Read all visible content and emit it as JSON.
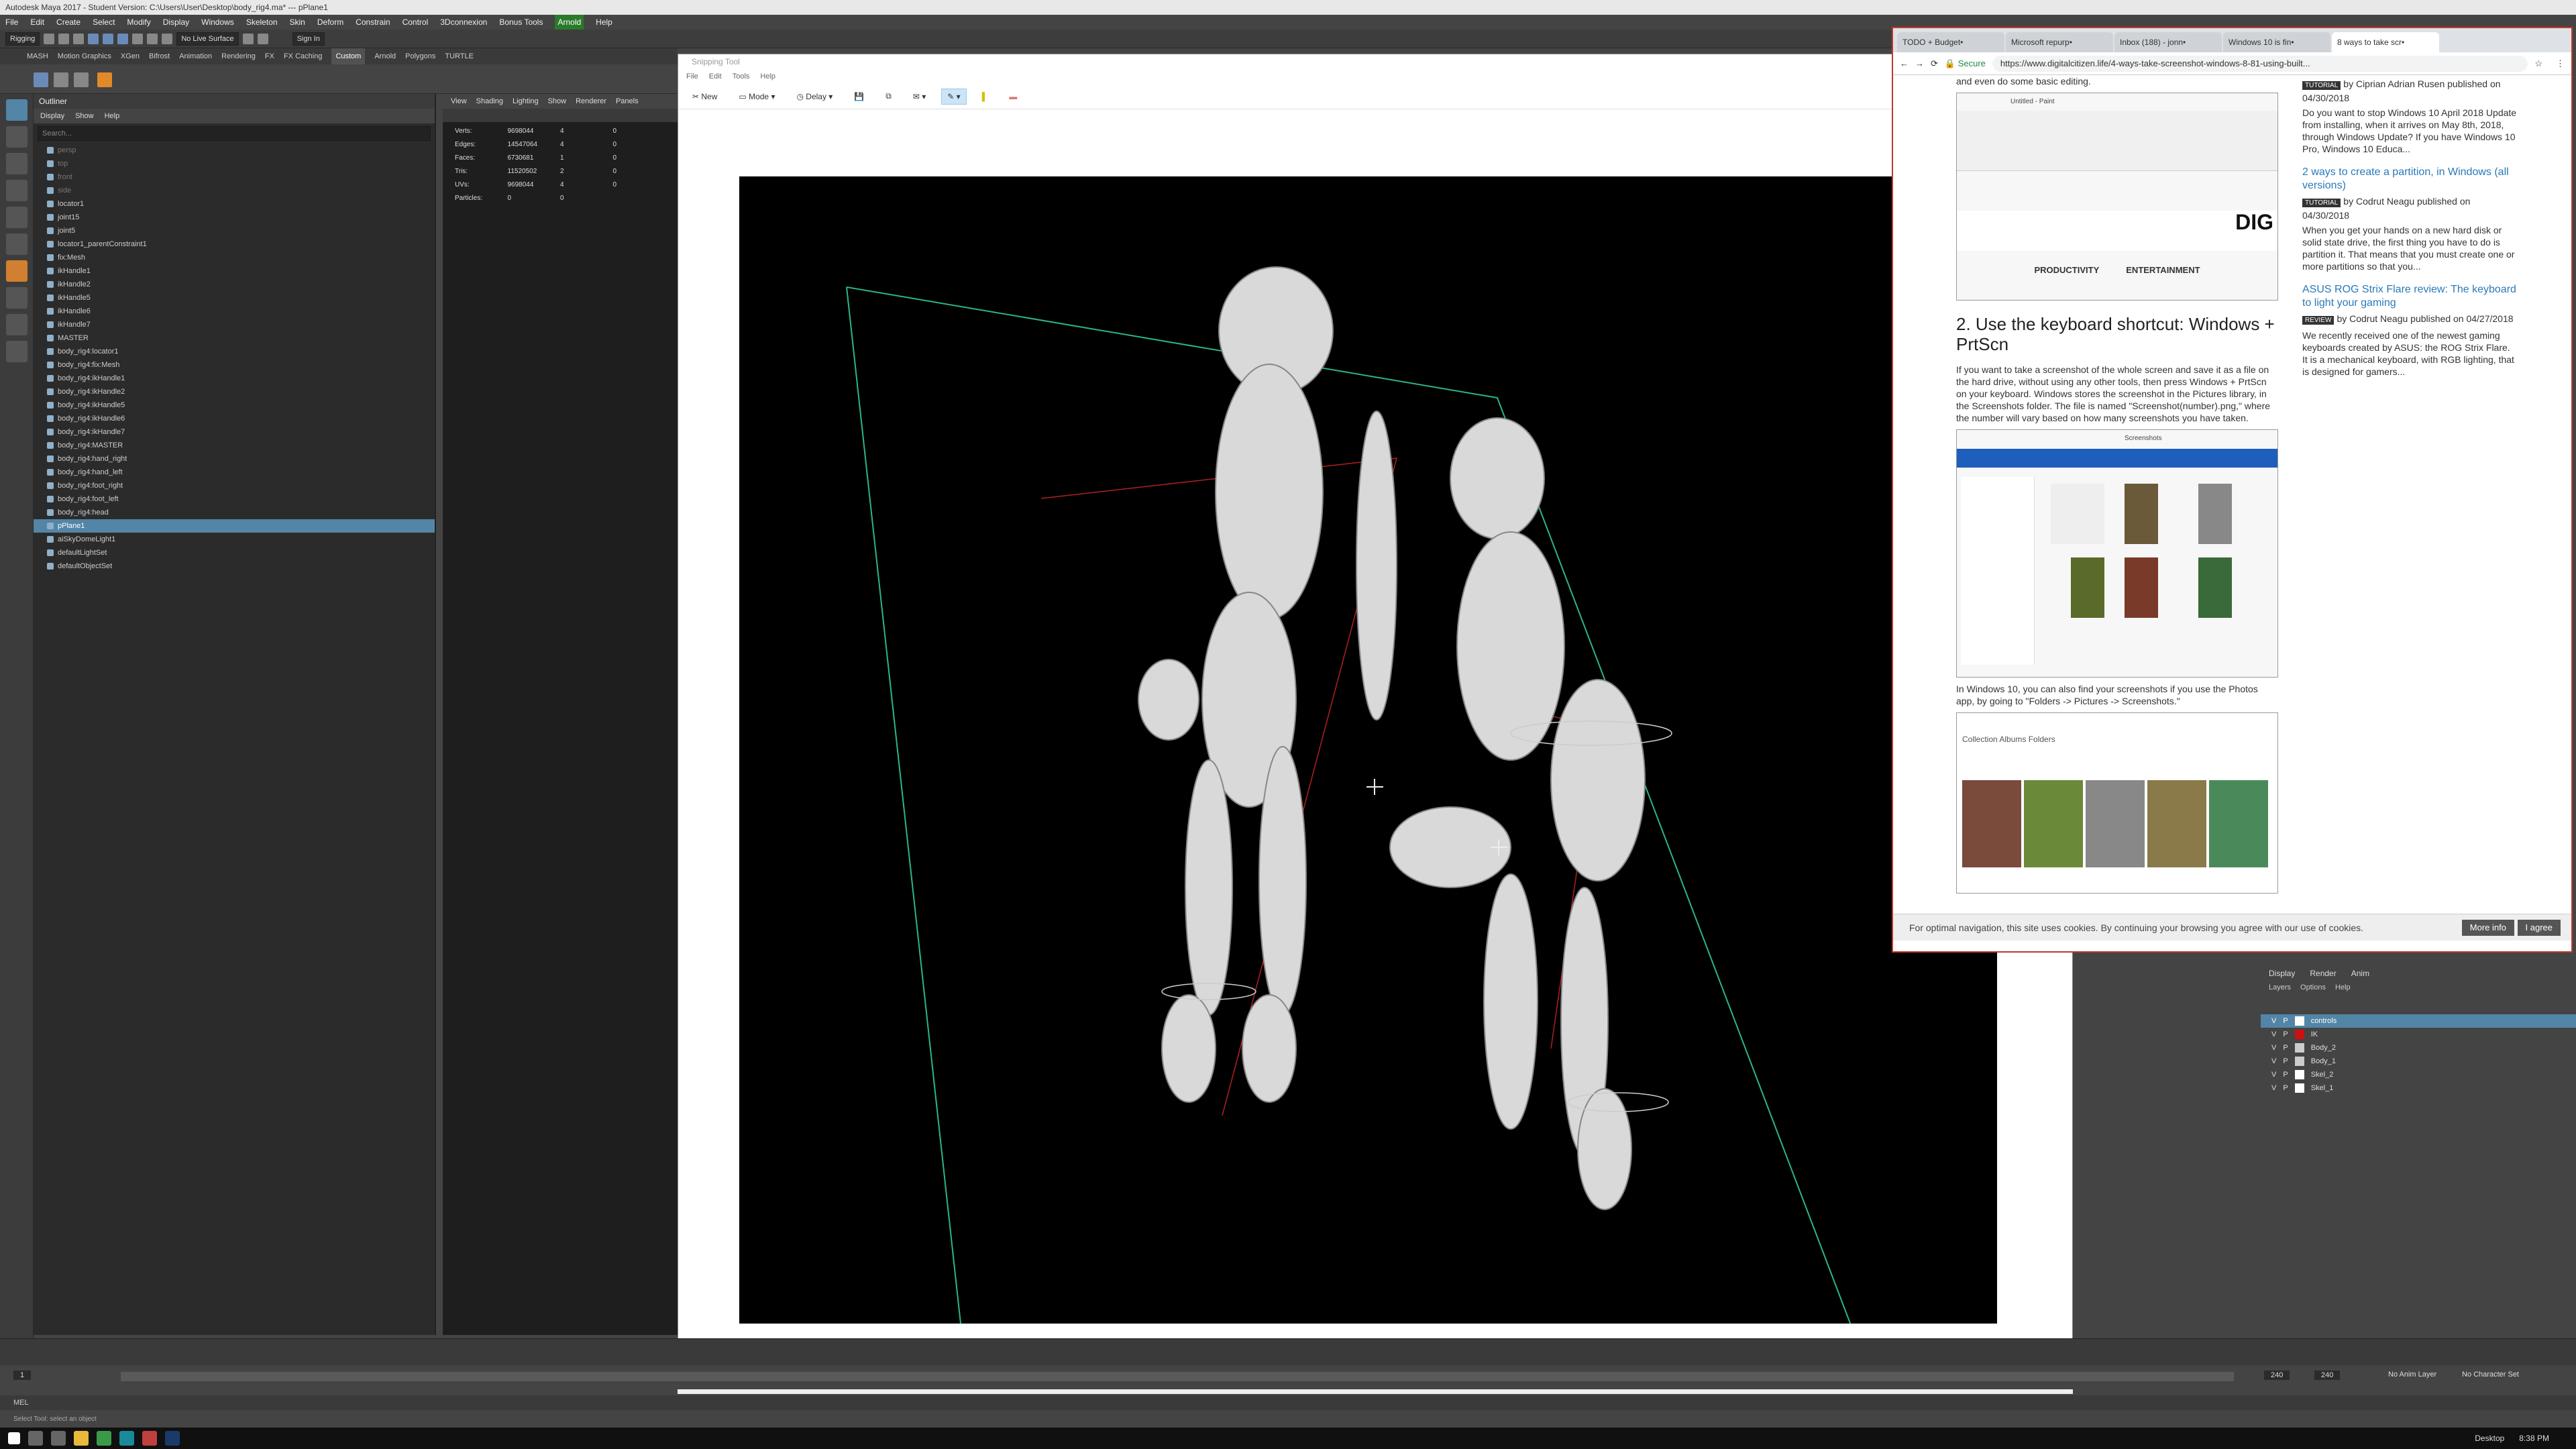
{
  "maya": {
    "title": "Autodesk Maya 2017 - Student Version: C:\\Users\\User\\Desktop\\body_rig4.ma* --- pPlane1",
    "menus": [
      "File",
      "Edit",
      "Create",
      "Select",
      "Modify",
      "Display",
      "Windows",
      "Skeleton",
      "Skin",
      "Deform",
      "Constrain",
      "Control",
      "3Dconnexion",
      "Bonus Tools",
      "Arnold",
      "Help"
    ],
    "mode_dropdown": "Rigging",
    "live_surface": "No Live Surface",
    "sign_in": "Sign In",
    "shelf_tabs": [
      "MASH",
      "Motion Graphics",
      "XGen",
      "Bifrost",
      "Animation",
      "Rendering",
      "FX",
      "FX Caching",
      "Custom",
      "Arnold",
      "Polygons",
      "TURTLE"
    ],
    "active_shelf": "Custom"
  },
  "outliner": {
    "title": "Outliner",
    "menus": [
      "Display",
      "Show",
      "Help"
    ],
    "search_placeholder": "Search...",
    "items": [
      {
        "label": "persp",
        "dim": true
      },
      {
        "label": "top",
        "dim": true
      },
      {
        "label": "front",
        "dim": true
      },
      {
        "label": "side",
        "dim": true
      },
      {
        "label": "locator1"
      },
      {
        "label": "joint15"
      },
      {
        "label": "joint5"
      },
      {
        "label": "locator1_parentConstraint1"
      },
      {
        "label": "fix:Mesh"
      },
      {
        "label": "ikHandle1"
      },
      {
        "label": "ikHandle2"
      },
      {
        "label": "ikHandle5"
      },
      {
        "label": "ikHandle6"
      },
      {
        "label": "ikHandle7"
      },
      {
        "label": "MASTER"
      },
      {
        "label": "body_rig4:locator1"
      },
      {
        "label": "body_rig4:fix:Mesh"
      },
      {
        "label": "body_rig4:ikHandle1"
      },
      {
        "label": "body_rig4:ikHandle2"
      },
      {
        "label": "body_rig4:ikHandle5"
      },
      {
        "label": "body_rig4:ikHandle6"
      },
      {
        "label": "body_rig4:ikHandle7"
      },
      {
        "label": "body_rig4:MASTER"
      },
      {
        "label": "body_rig4:hand_right"
      },
      {
        "label": "body_rig4:hand_left"
      },
      {
        "label": "body_rig4:foot_right"
      },
      {
        "label": "body_rig4:foot_left"
      },
      {
        "label": "body_rig4:head"
      },
      {
        "label": "pPlane1",
        "selected": true
      },
      {
        "label": "aiSkyDomeLight1"
      },
      {
        "label": "defaultLightSet"
      },
      {
        "label": "defaultObjectSet"
      }
    ]
  },
  "viewport": {
    "menus": [
      "View",
      "Shading",
      "Lighting",
      "Show",
      "Renderer",
      "Panels"
    ],
    "hud": [
      {
        "k": "Verts:",
        "a": "9698044",
        "b": "4",
        "c": "0"
      },
      {
        "k": "Edges:",
        "a": "14547064",
        "b": "4",
        "c": "0"
      },
      {
        "k": "Faces:",
        "a": "6730681",
        "b": "1",
        "c": "0"
      },
      {
        "k": "Tris:",
        "a": "11520502",
        "b": "2",
        "c": "0"
      },
      {
        "k": "UVs:",
        "a": "9698044",
        "b": "4",
        "c": "0"
      },
      {
        "k": "Particles:",
        "a": "0",
        "b": "0",
        "c": ""
      }
    ]
  },
  "snipping": {
    "title": "Snipping Tool",
    "menus": [
      "File",
      "Edit",
      "Tools",
      "Help"
    ],
    "new": "New",
    "mode": "Mode",
    "delay": "Delay"
  },
  "browser": {
    "tabs": [
      "TODO + Budget•",
      "Microsoft repurp•",
      "Inbox (188) - jonn•",
      "Windows 10 is fin•",
      "8 ways to take scr•"
    ],
    "secure": "Secure",
    "url": "https://www.digitalcitizen.life/4-ways-take-screenshot-windows-8-81-using-built...",
    "top_text": "and even do some basic editing.",
    "paint_title": "Untitled - Paint",
    "nav_productivity": "PRODUCTIVITY",
    "nav_entertainment": "ENTERTAINMENT",
    "heading": "2. Use the keyboard shortcut: Windows + PrtScn",
    "para1": "If you want to take a screenshot of the whole screen and save it as a file on the hard drive, without using any other tools, then press Windows + PrtScn on your keyboard. Windows stores the screenshot in the Pictures library, in the Screenshots folder. The file is named \"Screenshot(number).png,\" where the number will vary based on how many screenshots you have taken.",
    "para2": "In Windows 10, you can also find your screenshots if you use the Photos app, by going to \"Folders -> Pictures -> Screenshots.\"",
    "explorer_title": "Screenshots",
    "photos_tabs": "Collection   Albums   Folders",
    "sidebar": [
      {
        "byline": "by Ciprian Adrian Rusen published on 04/30/2018",
        "badge": "TUTORIAL",
        "text": "Do you want to stop Windows 10 April 2018 Update from installing, when it arrives on May 8th, 2018, through Windows Update? If you have Windows 10 Pro, Windows 10 Educa..."
      },
      {
        "title": "2 ways to create a partition, in Windows (all versions)",
        "badge": "TUTORIAL",
        "byline": "by Codrut Neagu published on 04/30/2018",
        "text": "When you get your hands on a new hard disk or solid state drive, the first thing you have to do is partition it. That means that you must create one or more partitions so that you..."
      },
      {
        "title": "ASUS ROG Strix Flare review: The keyboard to light your gaming",
        "badge": "REVIEW",
        "byline": "by Codrut Neagu published on 04/27/2018",
        "text": "We recently received one of the newest gaming keyboards created by ASUS: the ROG Strix Flare. It is a mechanical keyboard, with RGB lighting, that is designed for gamers..."
      }
    ],
    "cookie_text": "For optimal navigation, this site uses cookies. By continuing your browsing you agree with our use of cookies.",
    "more_info": "More info",
    "agree": "I agree"
  },
  "layers": {
    "tabs": [
      "Display",
      "Render",
      "Anim"
    ],
    "menus": [
      "Layers",
      "Options",
      "Help"
    ],
    "items": [
      {
        "name": "controls",
        "color": "#ffffff",
        "selected": true
      },
      {
        "name": "IK",
        "color": "#d01010"
      },
      {
        "name": "Body_2",
        "color": "#cccccc"
      },
      {
        "name": "Body_1",
        "color": "#cccccc"
      },
      {
        "name": "Skel_2",
        "color": "#ffffff"
      },
      {
        "name": "Skel_1",
        "color": "#ffffff"
      }
    ]
  },
  "timeline": {
    "start": "1",
    "end": "240",
    "end2": "240",
    "anim_layer": "No Anim Layer",
    "char_set": "No Character Set"
  },
  "status": {
    "cmd": "MEL",
    "help": "Select Tool: select an object"
  },
  "taskbar": {
    "desktop": "Desktop",
    "time": "8:38 PM"
  }
}
